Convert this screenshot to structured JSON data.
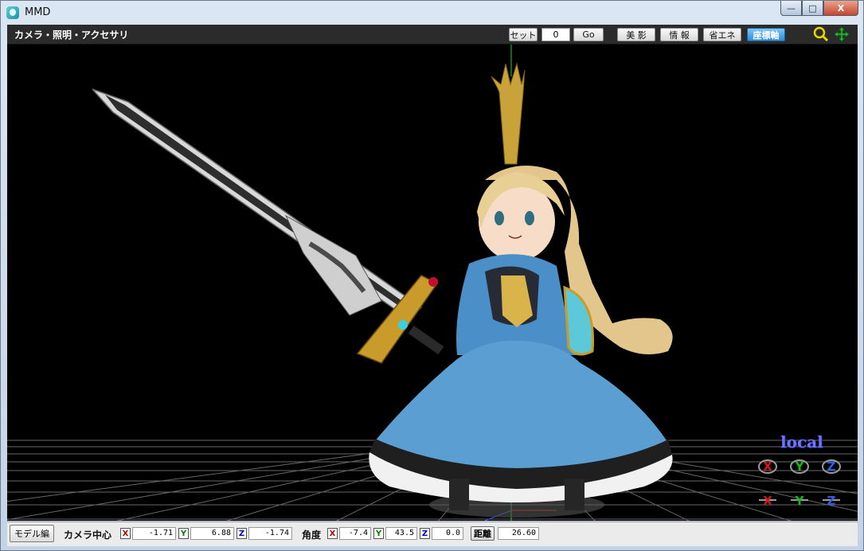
{
  "window": {
    "title": "MMD",
    "minimize_glyph": "—",
    "maximize_glyph": "□",
    "close_glyph": "X"
  },
  "toolbar": {
    "title": "カメラ・照明・アクセサリ",
    "set_label": "セット",
    "frame_value": "0",
    "go_label": "Go",
    "buttons": [
      "美 影",
      "情 報",
      "省エネ",
      "座標軸"
    ],
    "active_button": "座標軸"
  },
  "viewport": {
    "background": "#000000",
    "grid_color": "#8a8a8a",
    "local_label": "local",
    "gizmo_row1": [
      "X",
      "Y",
      "Z"
    ],
    "gizmo_row2": [
      "X",
      "Y",
      "Z"
    ],
    "icons": [
      "zoom-icon",
      "move-icon"
    ]
  },
  "status": {
    "model_edit_label": "モデル編",
    "camera_center_label": "カメラ中心",
    "camera_center": {
      "x": "-1.71",
      "y": "6.88",
      "z": "-1.74"
    },
    "angle_label": "角度",
    "angle": {
      "x": "-7.4",
      "y": "43.5",
      "z": "0.0"
    },
    "distance_label": "距離",
    "distance": "26.60",
    "axis_letters": {
      "x": "X",
      "y": "Y",
      "z": "Z"
    }
  }
}
